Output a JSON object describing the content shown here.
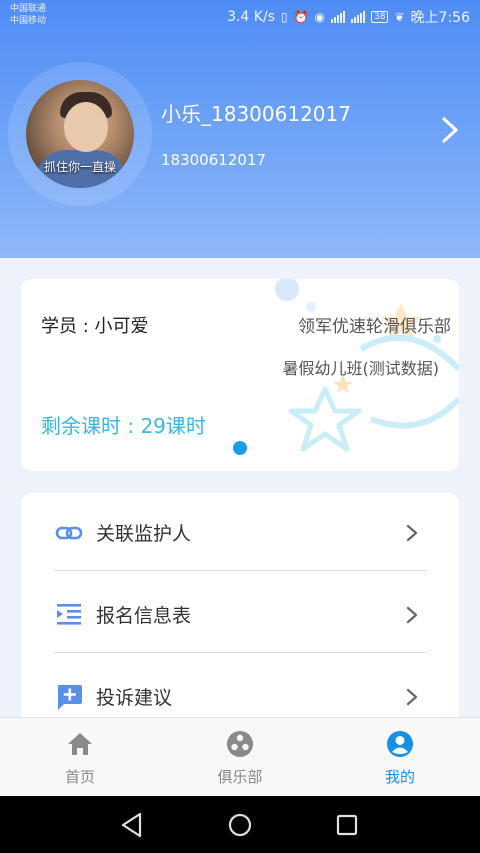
{
  "status_bar": {
    "carrier_1": "中国联通",
    "carrier_2": "中国移动",
    "speed": "3.4 K/s",
    "battery": "38",
    "time": "晚上7:56"
  },
  "profile": {
    "name": "小乐_18300612017",
    "phone": "18300612017",
    "avatar_caption": "抓住你一直操"
  },
  "student_card": {
    "student_label": "学员 : 小可爱",
    "club_name": "领军优速轮滑俱乐部",
    "class_name": "暑假幼儿班(测试数据)",
    "remaining_hours": "剩余课时 : 29课时"
  },
  "menu": {
    "items": [
      {
        "label": "关联监护人",
        "icon": "link-icon"
      },
      {
        "label": "报名信息表",
        "icon": "list-indent-icon"
      },
      {
        "label": "投诉建议",
        "icon": "feedback-plus-icon"
      }
    ]
  },
  "tabbar": {
    "tabs": [
      {
        "label": "首页",
        "icon": "home-icon"
      },
      {
        "label": "俱乐部",
        "icon": "club-icon"
      },
      {
        "label": "我的",
        "icon": "person-icon"
      }
    ],
    "active_index": 2
  },
  "colors": {
    "header_gradient_top": "#4f8cf6",
    "header_gradient_bottom": "#8fb8f9",
    "accent_blue": "#1a8fe6",
    "remaining_cyan": "#3bb6e6",
    "icon_blue": "#5b8ee6"
  }
}
